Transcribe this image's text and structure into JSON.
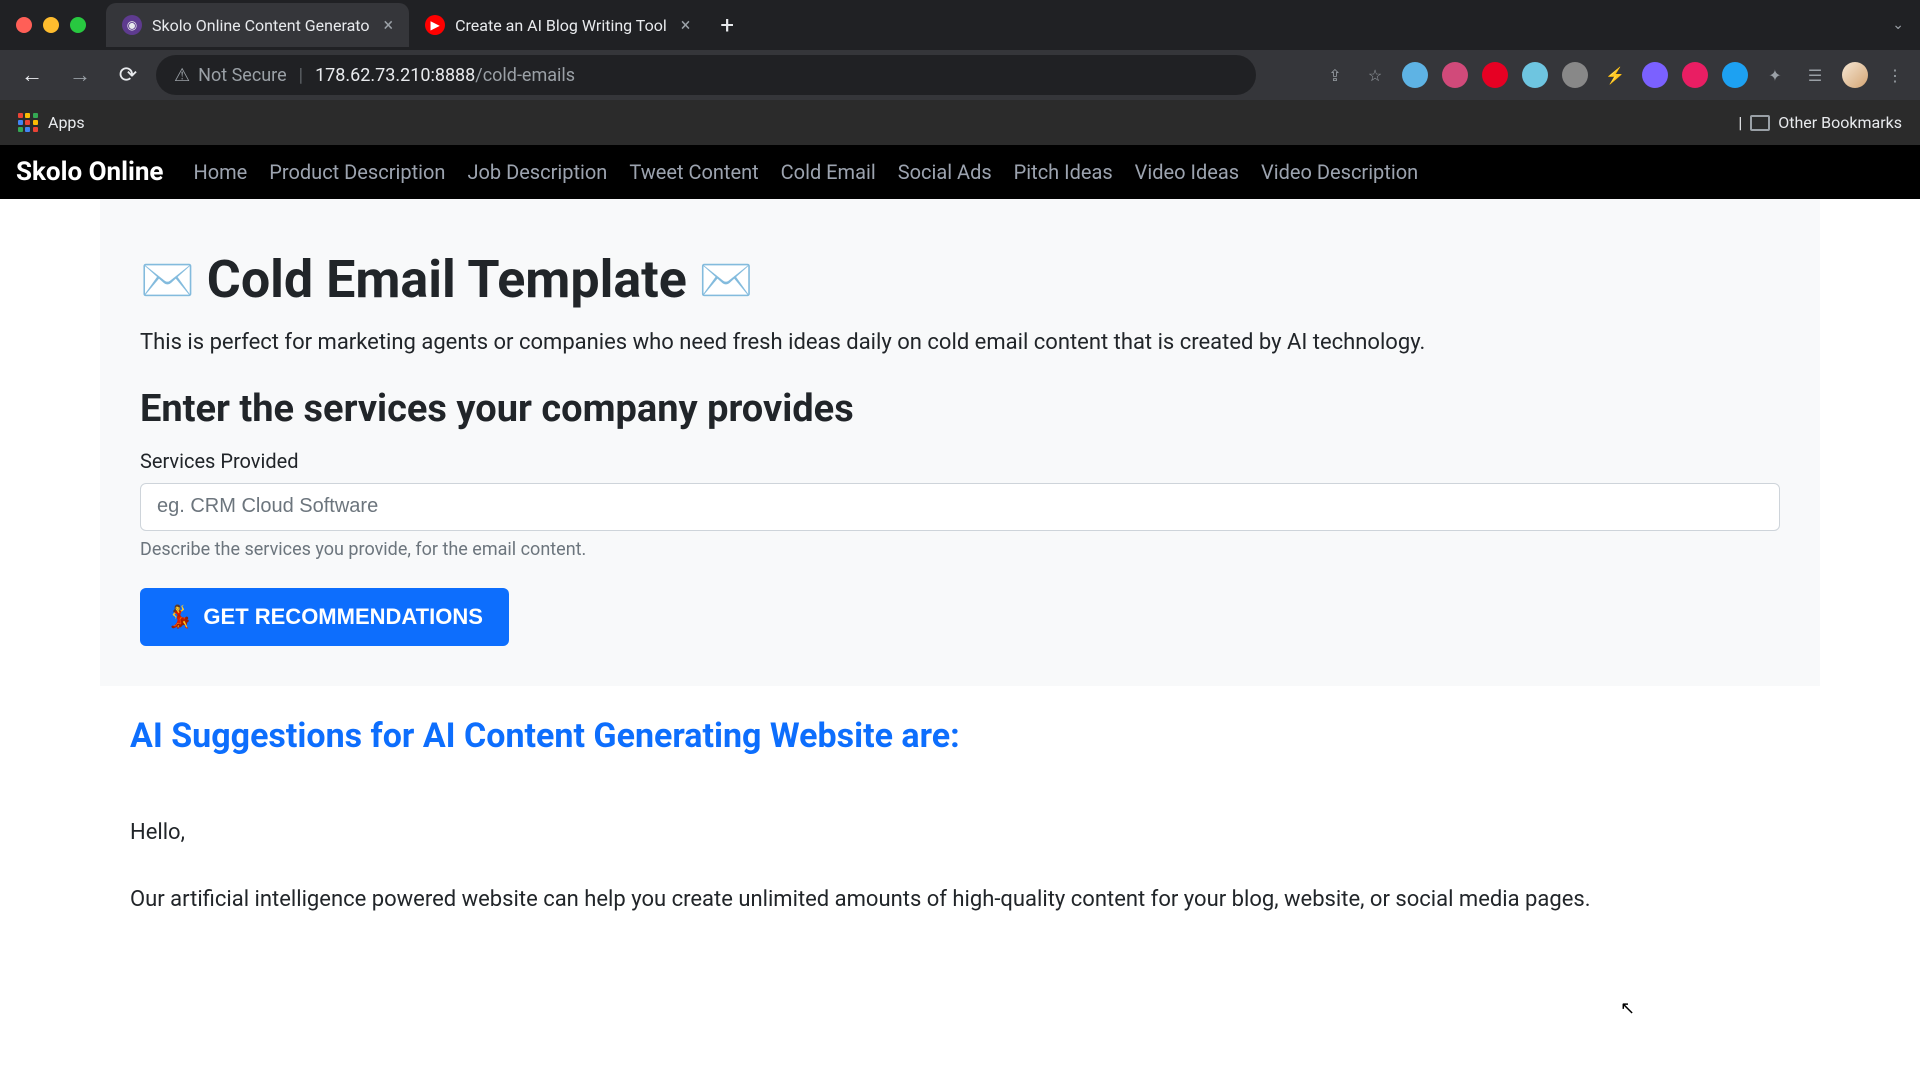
{
  "browser": {
    "tabs": [
      {
        "title": "Skolo Online Content Generato",
        "active": true
      },
      {
        "title": "Create an AI Blog Writing Tool",
        "active": false
      }
    ],
    "security_label": "Not Secure",
    "url_host": "178.62.73.210:8888",
    "url_path": "/cold-emails",
    "bookmarks": {
      "apps_label": "Apps",
      "other_label": "Other Bookmarks"
    },
    "ext_colors": [
      "#5eb3e4",
      "#d14a7a",
      "#e60023",
      "#6ec5e0",
      "#888888",
      "#f7b500",
      "#7b61ff",
      "#e91e63",
      "#1da1f2"
    ]
  },
  "nav": {
    "brand": "Skolo Online",
    "links": [
      "Home",
      "Product Description",
      "Job Description",
      "Tweet Content",
      "Cold Email",
      "Social Ads",
      "Pitch Ideas",
      "Video Ideas",
      "Video Description"
    ]
  },
  "page": {
    "title": "Cold Email Template",
    "subtitle": "This is perfect for marketing agents or companies who need fresh ideas daily on cold email content that is created by AI technology.",
    "section_heading": "Enter the services your company provides",
    "field_label": "Services Provided",
    "placeholder": "eg. CRM Cloud Software",
    "help_text": "Describe the services you provide, for the email content.",
    "button_label": "GET RECOMMENDATIONS"
  },
  "results": {
    "title": "AI Suggestions for AI Content Generating Website are:",
    "greeting": "Hello,",
    "body": "Our artificial intelligence powered website can help you create unlimited amounts of high-quality content for your blog, website, or social media pages."
  }
}
